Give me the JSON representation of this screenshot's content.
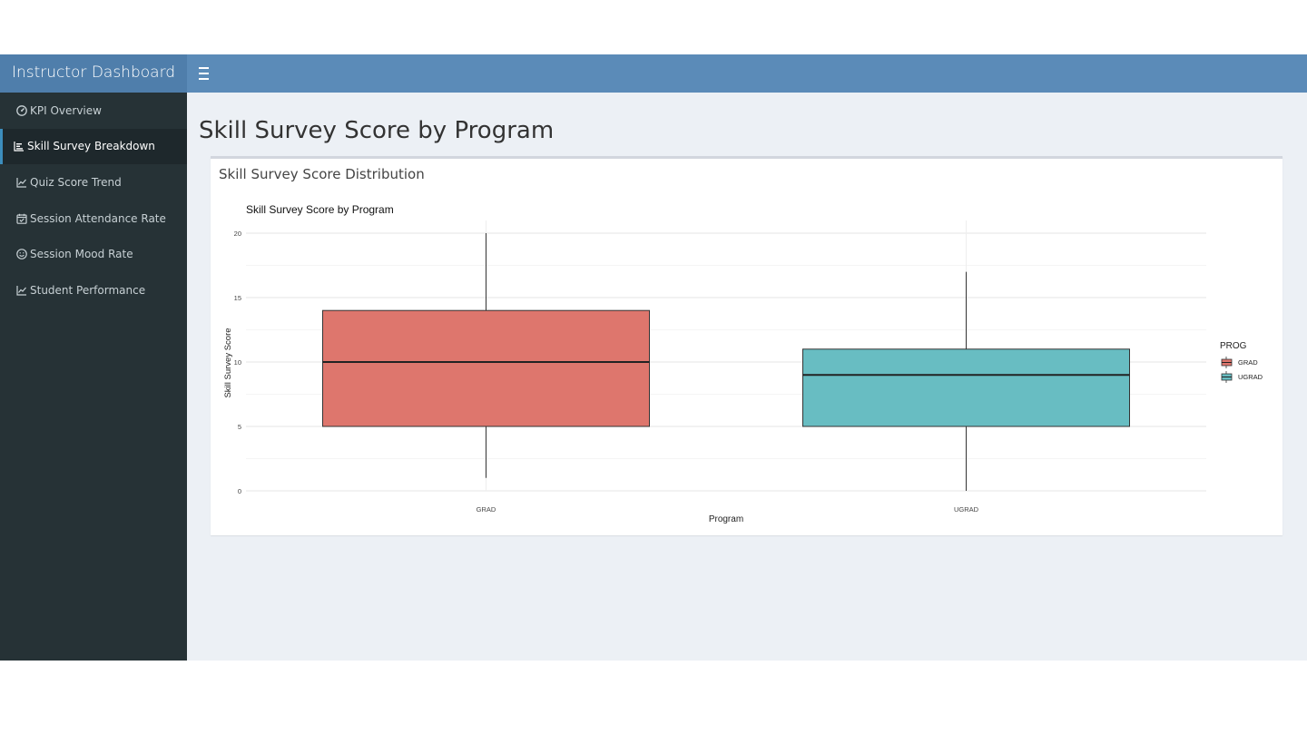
{
  "app": {
    "title": "Instructor Dashboard"
  },
  "sidebar": {
    "items": [
      {
        "label": "KPI Overview",
        "icon": "tachometer-icon",
        "active": false
      },
      {
        "label": "Skill Survey Breakdown",
        "icon": "bar-chart-icon",
        "active": true
      },
      {
        "label": "Quiz Score Trend",
        "icon": "line-chart-icon",
        "active": false
      },
      {
        "label": "Session Attendance Rate",
        "icon": "calendar-check-icon",
        "active": false
      },
      {
        "label": "Session Mood Rate",
        "icon": "smile-icon",
        "active": false
      },
      {
        "label": "Student Performance",
        "icon": "line-chart-icon",
        "active": false
      }
    ]
  },
  "main": {
    "page_title": "Skill Survey Score by Program",
    "box_title": "Skill Survey Score Distribution"
  },
  "chart_data": {
    "type": "boxplot",
    "title": "Skill Survey Score by Program",
    "xlabel": "Program",
    "ylabel": "Skill Survey Score",
    "ylim": [
      0,
      20
    ],
    "yticks": [
      0,
      5,
      10,
      15,
      20
    ],
    "categories": [
      "GRAD",
      "UGRAD"
    ],
    "legend": {
      "title": "PROG",
      "entries": [
        "GRAD",
        "UGRAD"
      ],
      "placement": "right"
    },
    "grid": true,
    "series": [
      {
        "name": "GRAD",
        "color": "#de766d",
        "min": 1,
        "q1": 5,
        "median": 10,
        "q3": 14,
        "max": 20
      },
      {
        "name": "UGRAD",
        "color": "#68bdc2",
        "min": 0,
        "q1": 5,
        "median": 9,
        "q3": 11,
        "max": 17
      }
    ]
  },
  "colors": {
    "header": "#5b8bb8",
    "sidebar": "#263236",
    "grad": "#de766d",
    "ugrad": "#68bdc2"
  }
}
